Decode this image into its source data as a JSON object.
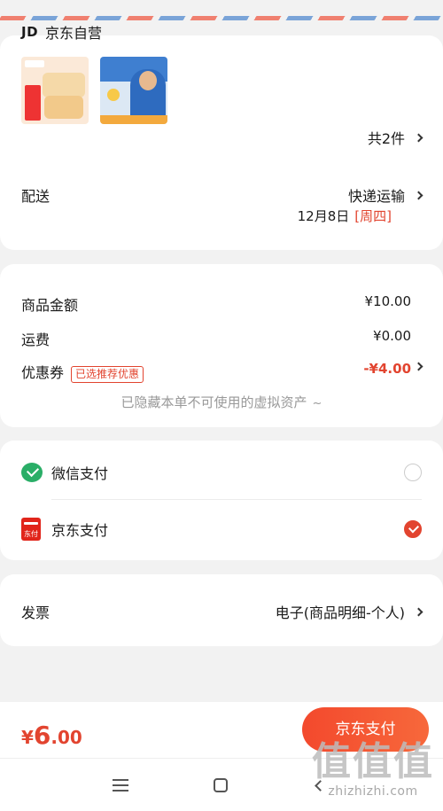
{
  "order": {
    "store_logo": "JD",
    "store_name": "京东自营",
    "item_count": "共2件",
    "shipping_label": "配送",
    "shipping_method": "快递运输",
    "shipping_date": "12月8日",
    "shipping_weekday": "[周四]"
  },
  "amounts": {
    "goods_label": "商品金额",
    "goods_value": "¥10.00",
    "freight_label": "运费",
    "freight_value": "¥0.00",
    "coupon_label": "优惠券",
    "coupon_tag": "已选推荐优惠",
    "coupon_value": "-¥4.00",
    "hidden_note": "已隐藏本单不可使用的虚拟资产",
    "hidden_note_suffix": "~"
  },
  "payment": {
    "options": [
      {
        "label": "微信支付",
        "icon": "wechat-pay-icon",
        "selected": false
      },
      {
        "label": "京东支付",
        "icon": "jd-pay-icon",
        "icon_text": "东付",
        "selected": true
      }
    ]
  },
  "invoice": {
    "label": "发票",
    "value": "电子(商品明细-个人)"
  },
  "footer": {
    "total_currency": "¥",
    "total_int": "6",
    "total_dec": ".00",
    "pay_button": "京东支付"
  },
  "watermark": {
    "big": "值值值",
    "small": "zhizhizhi.com"
  },
  "colors": {
    "accent": "#e2442f",
    "wechat_green": "#2aae67",
    "jd_red": "#e1251b"
  }
}
